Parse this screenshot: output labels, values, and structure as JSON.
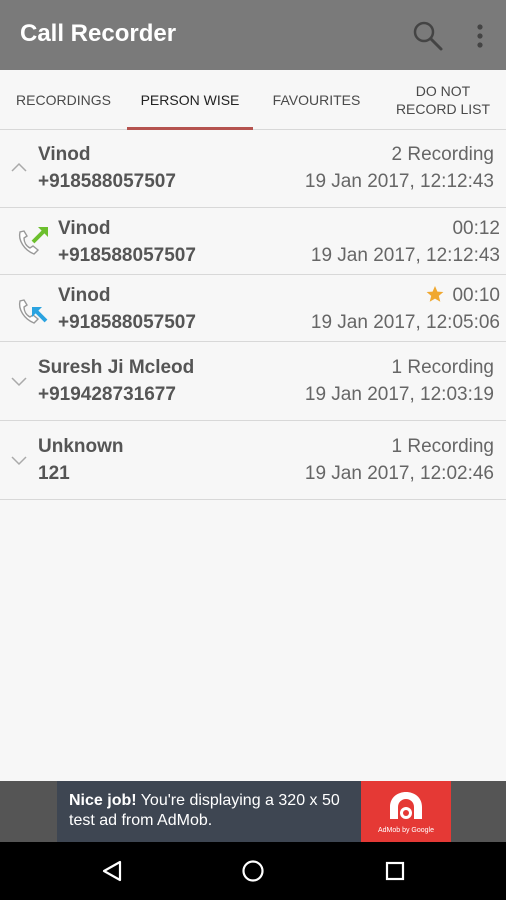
{
  "app": {
    "title": "Call Recorder"
  },
  "tabs": [
    {
      "label": "RECORDINGS"
    },
    {
      "label": "PERSON WISE"
    },
    {
      "label": "FAVOURITES"
    },
    {
      "label_line1": "DO NOT",
      "label_line2": "RECORD LIST"
    }
  ],
  "rows": [
    {
      "name": "Vinod",
      "number": "+918588057507",
      "right_top": "2 Recording",
      "right_bottom": "19 Jan 2017, 12:12:43",
      "icon": "chevron-up-icon"
    },
    {
      "name": "Vinod",
      "number": "+918588057507",
      "right_top": "00:12",
      "right_bottom": "19 Jan 2017, 12:12:43",
      "icon": "outgoing-call-icon"
    },
    {
      "name": "Vinod",
      "number": "+918588057507",
      "right_top": "00:10",
      "right_bottom": "19 Jan 2017, 12:05:06",
      "icon": "incoming-call-icon",
      "favourite": true
    },
    {
      "name": "Suresh Ji Mcleod",
      "number": "+919428731677",
      "right_top": "1 Recording",
      "right_bottom": "19 Jan 2017, 12:03:19",
      "icon": "chevron-down-icon"
    },
    {
      "name": "Unknown",
      "number": "121",
      "right_top": "1 Recording",
      "right_bottom": "19 Jan 2017, 12:02:46",
      "icon": "chevron-down-icon"
    }
  ],
  "ad": {
    "bold": "Nice job!",
    "text": " You're displaying a 320 x 50 test ad from AdMob.",
    "logo_text": "AdMob by Google"
  },
  "colors": {
    "appbar": "#7a7a7a",
    "accent": "#b5534f",
    "outgoing_arrow": "#6cbf2d",
    "incoming_arrow": "#2ba3e0",
    "star": "#f0a830"
  }
}
